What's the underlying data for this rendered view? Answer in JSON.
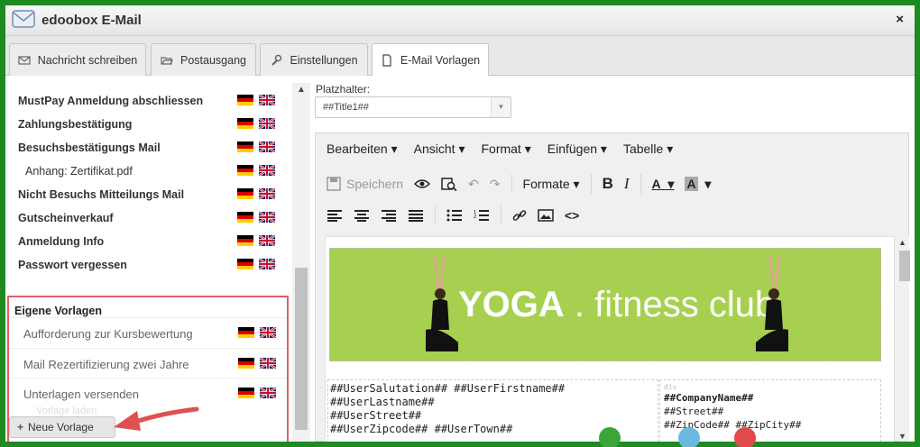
{
  "window": {
    "title": "edoobox E-Mail",
    "close_icon": "×"
  },
  "tabs": [
    {
      "label": "Nachricht schreiben",
      "icon": "envelope-icon",
      "active": false
    },
    {
      "label": "Postausgang",
      "icon": "folder-open-icon",
      "active": false
    },
    {
      "label": "Einstellungen",
      "icon": "wrench-icon",
      "active": false
    },
    {
      "label": "E-Mail Vorlagen",
      "icon": "document-icon",
      "active": true
    }
  ],
  "templates": [
    {
      "label": "MustPay Anmeldung abschliessen"
    },
    {
      "label": "Zahlungsbestätigung"
    },
    {
      "label": "Besuchsbestätigungs Mail"
    },
    {
      "label": "Anhang: Zertifikat.pdf"
    },
    {
      "label": "Nicht Besuchs Mitteilungs Mail"
    },
    {
      "label": "Gutscheinverkauf"
    },
    {
      "label": "Anmeldung Info"
    },
    {
      "label": "Passwort vergessen"
    }
  ],
  "own_templates": {
    "title": "Eigene Vorlagen",
    "items": [
      {
        "label": "Aufforderung zur Kursbewertung"
      },
      {
        "label": "Mail Rezertifizierung zwei Jahre"
      },
      {
        "label": "Unterlagen versenden"
      }
    ],
    "faded_label": "Vorlage laden",
    "new_button": "Neue Vorlage"
  },
  "placeholder": {
    "label": "Platzhalter:",
    "value": "##Title1##"
  },
  "editor": {
    "menus": [
      "Bearbeiten",
      "Ansicht",
      "Format",
      "Einfügen",
      "Tabelle"
    ],
    "save_label": "Speichern",
    "formats_label": "Formate",
    "banner_bold": "YOGA",
    "banner_rest": " . fitness club",
    "user_vars": [
      "##UserSalutation## ##UserFirstname##",
      "##UserLastname##",
      "##UserStreet##",
      "##UserZipcode## ##UserTown##"
    ],
    "company_tag": "div",
    "company_vars": [
      "##CompanyName##",
      "##Street##",
      "##ZipCode## ##ZipCity##"
    ]
  },
  "colors": {
    "accent_green": "#1f8a1f",
    "banner_green": "#a7d051",
    "annotation_red": "#e05050"
  }
}
